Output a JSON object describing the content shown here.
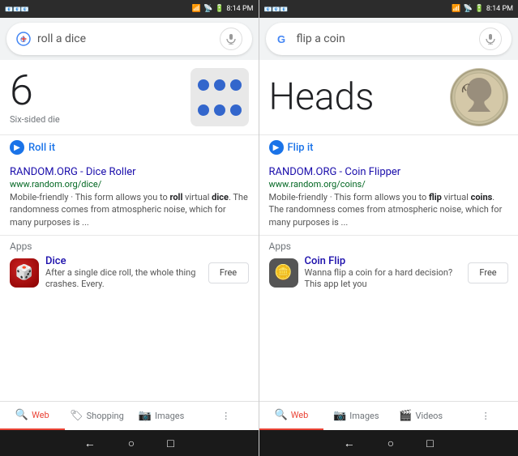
{
  "left_panel": {
    "status_bar": {
      "time": "8:14 PM",
      "icons_left": [
        "notification",
        "gmail1",
        "gmail2",
        "gmail3"
      ],
      "icons_right": [
        "wifi",
        "signal",
        "battery"
      ]
    },
    "search_bar": {
      "query": "roll a dice",
      "placeholder": "roll a dice"
    },
    "result_card": {
      "number": "6",
      "label": "Six-sided die"
    },
    "action_button": "Roll it",
    "search_result": {
      "title": "RANDOM.ORG - Dice Roller",
      "url": "www.random.org/dice/",
      "snippet": "Mobile-friendly · This form allows you to roll virtual dice. The randomness comes from atmospheric noise, which for many purposes is ..."
    },
    "apps_section": {
      "label": "Apps",
      "app": {
        "name": "Dice",
        "description": "After a single dice roll, the whole thing crashes. Every.",
        "button": "Free"
      }
    },
    "bottom_nav": {
      "tabs": [
        "Web",
        "Shopping",
        "Images"
      ],
      "active": "Web",
      "more_icon": "⋮"
    }
  },
  "right_panel": {
    "status_bar": {
      "time": "8:14 PM"
    },
    "search_bar": {
      "query": "flip a coin",
      "placeholder": "flip a coin"
    },
    "result_card": {
      "text": "Heads"
    },
    "action_button": "Flip it",
    "search_result": {
      "title": "RANDOM.ORG - Coin Flipper",
      "url": "www.random.org/coins/",
      "snippet": "Mobile-friendly · This form allows you to flip virtual coins. The randomness comes from atmospheric noise, which for many purposes is ..."
    },
    "apps_section": {
      "label": "Apps",
      "app": {
        "name": "Coin Flip",
        "description": "Wanna flip a coin for a hard decision? This app let you",
        "button": "Free"
      }
    },
    "bottom_nav": {
      "tabs": [
        "Web",
        "Images",
        "Videos"
      ],
      "active": "Web",
      "more_icon": "⋮"
    }
  },
  "system_nav": {
    "back": "←",
    "home": "○",
    "recents": "□"
  }
}
